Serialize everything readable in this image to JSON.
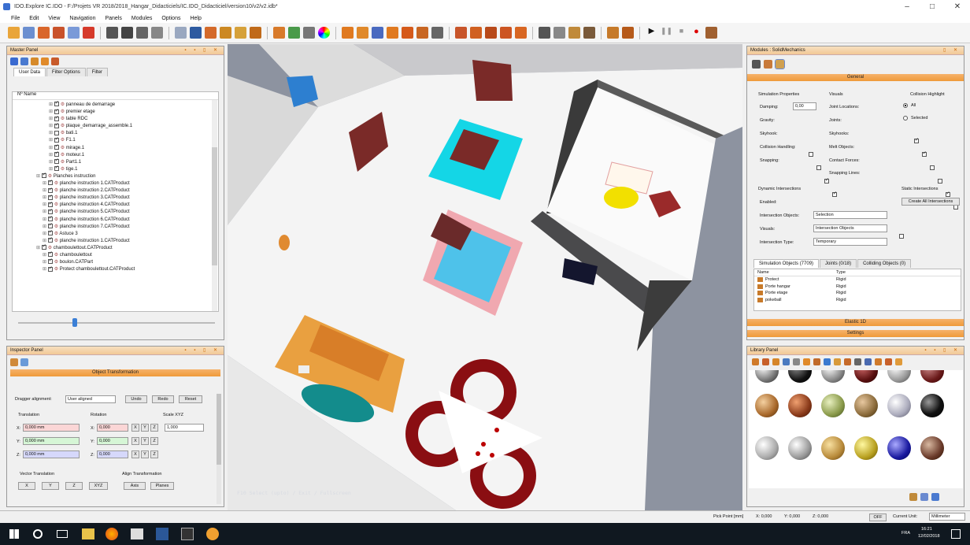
{
  "title": "IDO.Explore IC.IDO - F:/Projets VR 2018/2018_Hangar_Didacticiels/IC.IDO_Didacticiel/version10/v2/v2.idb*",
  "window_controls": [
    "–",
    "□",
    "✕"
  ],
  "menu": [
    "File",
    "Edit",
    "View",
    "Navigation",
    "Panels",
    "Modules",
    "Options",
    "Help"
  ],
  "master_panel": {
    "title": "Master Panel",
    "tabs": [
      "User Data",
      "Filter Options",
      "Filter"
    ],
    "col_nr": "Nº",
    "col_name": "Name",
    "tree": [
      {
        "label": "panneau de demarrage",
        "indent": 4,
        "checked": true
      },
      {
        "label": "premier etage",
        "indent": 4,
        "checked": true
      },
      {
        "label": "table RDC",
        "indent": 4,
        "checked": true
      },
      {
        "label": "plaque_demarrage_assemble.1",
        "indent": 4,
        "checked": true
      },
      {
        "label": "bati.1",
        "indent": 4,
        "checked": false
      },
      {
        "label": "F1.1",
        "indent": 4,
        "checked": true
      },
      {
        "label": "mirage.1",
        "indent": 4,
        "checked": true
      },
      {
        "label": "moteur.1",
        "indent": 4,
        "checked": true
      },
      {
        "label": "Part1.1",
        "indent": 4,
        "checked": true
      },
      {
        "label": "tige.1",
        "indent": 4,
        "checked": true
      },
      {
        "label": "Planches instruction",
        "indent": 2,
        "checked": true
      },
      {
        "label": "planche instruction 1.CATProduct",
        "indent": 3,
        "checked": true
      },
      {
        "label": "planche instruction 2.CATProduct",
        "indent": 3,
        "checked": true
      },
      {
        "label": "planche instruction 3.CATProduct",
        "indent": 3,
        "checked": true
      },
      {
        "label": "planche instruction 4.CATProduct",
        "indent": 3,
        "checked": true
      },
      {
        "label": "planche instruction 5.CATProduct",
        "indent": 3,
        "checked": true
      },
      {
        "label": "planche instruction 6.CATProduct",
        "indent": 3,
        "checked": true
      },
      {
        "label": "planche instruction 7.CATProduct",
        "indent": 3,
        "checked": true
      },
      {
        "label": "Astuce 3",
        "indent": 3,
        "checked": true
      },
      {
        "label": "planche instruction 1.CATProduct",
        "indent": 3,
        "checked": true
      },
      {
        "label": "chamboulettout.CATProduct",
        "indent": 2,
        "checked": true
      },
      {
        "label": "chamboulettout",
        "indent": 3,
        "checked": true
      },
      {
        "label": "boulon.CATPart",
        "indent": 3,
        "checked": true
      },
      {
        "label": "Protect chamboulettout.CATProduct",
        "indent": 3,
        "checked": true
      }
    ]
  },
  "inspector_panel": {
    "title": "Inspector Panel",
    "section": "Object Transformation",
    "dragger_label": "Dragger alignment:",
    "dragger_value": "User aligned",
    "undo": "Undo",
    "redo": "Redo",
    "reset": "Reset",
    "translation_label": "Translation",
    "rotation_label": "Rotation",
    "scale_label": "Scale XYZ",
    "tx": "0,000 mm",
    "ty": "0,000 mm",
    "tz": "0,000 mm",
    "rx": "0,000",
    "ry": "0,000",
    "rz": "0,000",
    "scale": "1,000",
    "axis_x": "X:",
    "axis_y": "Y:",
    "axis_z": "Z:",
    "xyz_btns": [
      "X",
      "Y",
      "Z"
    ],
    "vector_label": "Vector Translation",
    "vector_btns": [
      "X",
      "Y",
      "Z",
      "XYZ"
    ],
    "align_label": "Align Transformation",
    "align_btns": [
      "Axis",
      "Planes"
    ]
  },
  "modules_panel": {
    "title": "Modules : SolidMechanics",
    "general": "General",
    "sim_props": "Simulation Properties",
    "damping_label": "Damping:",
    "damping_value": "0,00",
    "gravity": "Gravity:",
    "skyhook": "Skyhook:",
    "collision_handling": "Collision Handling:",
    "snapping": "Snapping:",
    "visuals": "Visuals",
    "joint_locations": "Joint Locations:",
    "joints": "Joints:",
    "skyhooks": "Skyhooks:",
    "melt_objects": "Melt Objects:",
    "contact_forces": "Contact Forces:",
    "snapping_lines": "Snapping Lines:",
    "collision_highlight": "Collision Highlight",
    "radio_all": "All",
    "radio_selected": "Selected",
    "dynamic_intersections": "Dynamic Intersections",
    "static_intersections": "Static Intersections",
    "enabled": "Enabled:",
    "intersection_objects": "Intersection Objects:",
    "intersection_objects_value": "Selection",
    "visuals_label": "Visuals:",
    "visuals_value": "Intersection Objects",
    "intersection_type": "Intersection Type:",
    "intersection_type_value": "Temporary",
    "create_all": "Create All Intersections",
    "tabs": [
      "Simulation Objects (7709)",
      "Joints (0/18)",
      "Colliding Objects (0)"
    ],
    "col_name": "Name",
    "col_type": "Type",
    "objects": [
      {
        "name": "Protect",
        "type": "Rigid"
      },
      {
        "name": "Porte hangar",
        "type": "Rigid"
      },
      {
        "name": "Porte etage",
        "type": "Rigid"
      },
      {
        "name": "pokeball",
        "type": "Rigid"
      }
    ],
    "elastic": "Elastic 1D",
    "settings": "Settings"
  },
  "library_panel": {
    "title": "Library Panel"
  },
  "viewport": {
    "overlay_text": "F10 Select (upto) / Exit / Fullscreen"
  },
  "statusbar": {
    "pick_label": "Pick Point [mm]",
    "x": "X: 0,000",
    "y": "Y: 0,000",
    "z": "Z: 0,000",
    "off": "OFF",
    "unit_label": "Current Unit:",
    "unit": "Millimeter"
  },
  "taskbar": {
    "lang": "FRA",
    "time": "16:21",
    "date": "12/02/2018"
  },
  "colors": {
    "accent": "#f2b46a",
    "viewport_bg": "#8d93a0",
    "floor": "#f4f4f4"
  }
}
